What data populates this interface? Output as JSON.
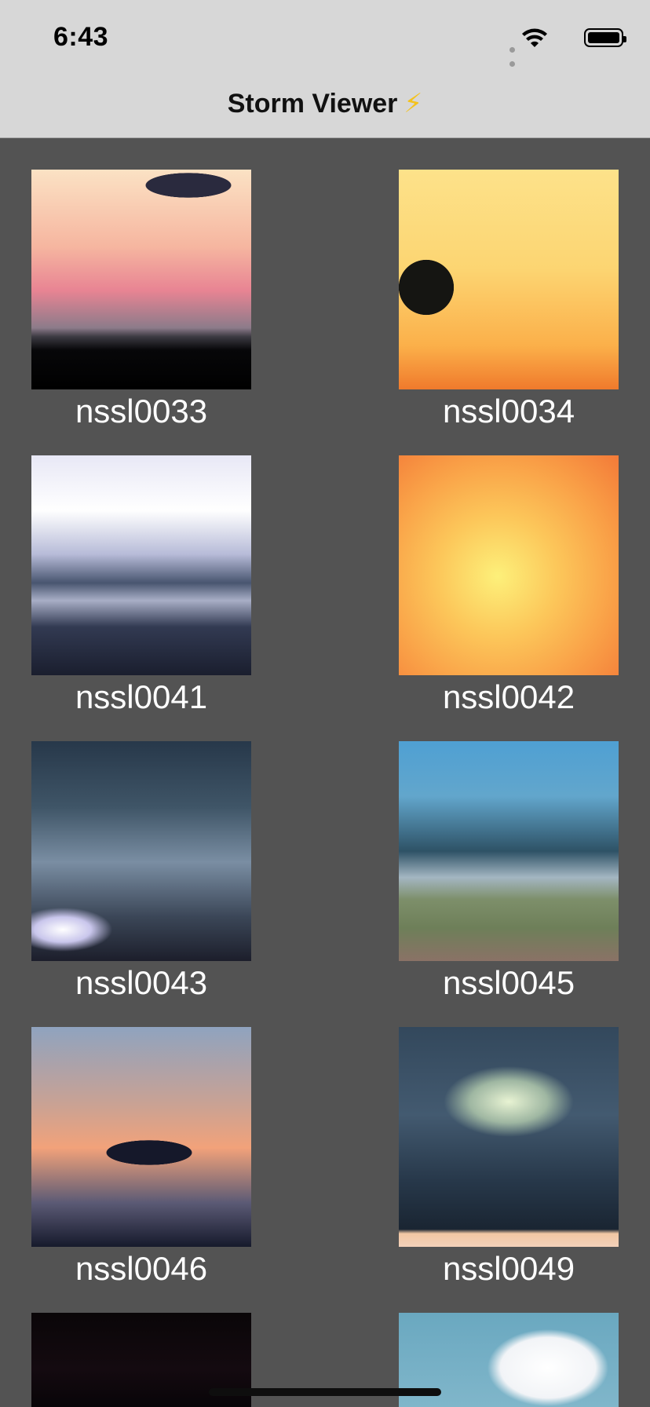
{
  "status_bar": {
    "time": "6:43"
  },
  "navigation": {
    "title": "Storm Viewer",
    "title_icon": "⚡"
  },
  "colors": {
    "background": "#535353",
    "bar_background": "#d7d7d7",
    "caption_text": "#ffffff"
  },
  "items": [
    {
      "name": "nssl0033",
      "icon": "storm-photo"
    },
    {
      "name": "nssl0034",
      "icon": "storm-photo"
    },
    {
      "name": "nssl0041",
      "icon": "storm-photo"
    },
    {
      "name": "nssl0042",
      "icon": "storm-photo"
    },
    {
      "name": "nssl0043",
      "icon": "storm-photo"
    },
    {
      "name": "nssl0045",
      "icon": "storm-photo"
    },
    {
      "name": "nssl0046",
      "icon": "storm-photo"
    },
    {
      "name": "nssl0049",
      "icon": "storm-photo"
    },
    {
      "name": "",
      "icon": "storm-photo"
    },
    {
      "name": "",
      "icon": "storm-photo"
    }
  ]
}
